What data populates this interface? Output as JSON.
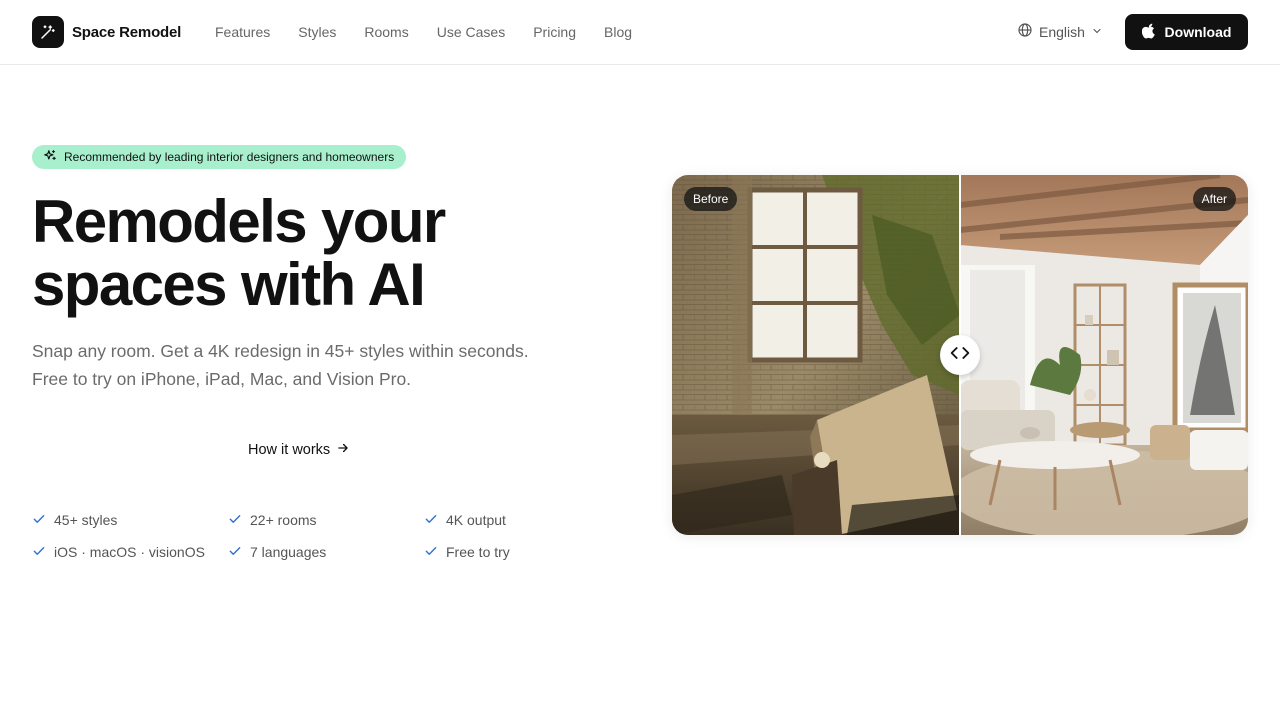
{
  "brand": {
    "name": "Space Remodel",
    "icon": "magic-wand-icon"
  },
  "nav": {
    "items": [
      {
        "label": "Features"
      },
      {
        "label": "Styles"
      },
      {
        "label": "Rooms"
      },
      {
        "label": "Use Cases"
      },
      {
        "label": "Pricing"
      },
      {
        "label": "Blog"
      }
    ]
  },
  "language": {
    "label": "English",
    "icon": "globe-icon"
  },
  "download": {
    "label": "Download",
    "icon": "apple-icon"
  },
  "hero": {
    "badge": "Recommended by leading interior designers and homeowners",
    "headline_line1": "Remodels your",
    "headline_line2": "spaces with AI",
    "sub_line1": "Snap any room. Get a 4K redesign in 45+ styles within seconds.",
    "sub_line2": "Free to try on iPhone, iPad, Mac, and Vision Pro.",
    "cta": "How it works"
  },
  "features": [
    {
      "label": "45+ styles"
    },
    {
      "label": "22+ rooms"
    },
    {
      "label": "4K output"
    },
    {
      "label": "iOS · macOS · visionOS"
    },
    {
      "label": "7 languages"
    },
    {
      "label": "Free to try"
    }
  ],
  "compare": {
    "before_label": "Before",
    "after_label": "After",
    "slider_position": 0.5
  },
  "colors": {
    "accent_dark": "#111111",
    "badge_bg": "#a8f0cd",
    "check": "#2f6fd6",
    "muted_text": "#6b6b6b"
  }
}
